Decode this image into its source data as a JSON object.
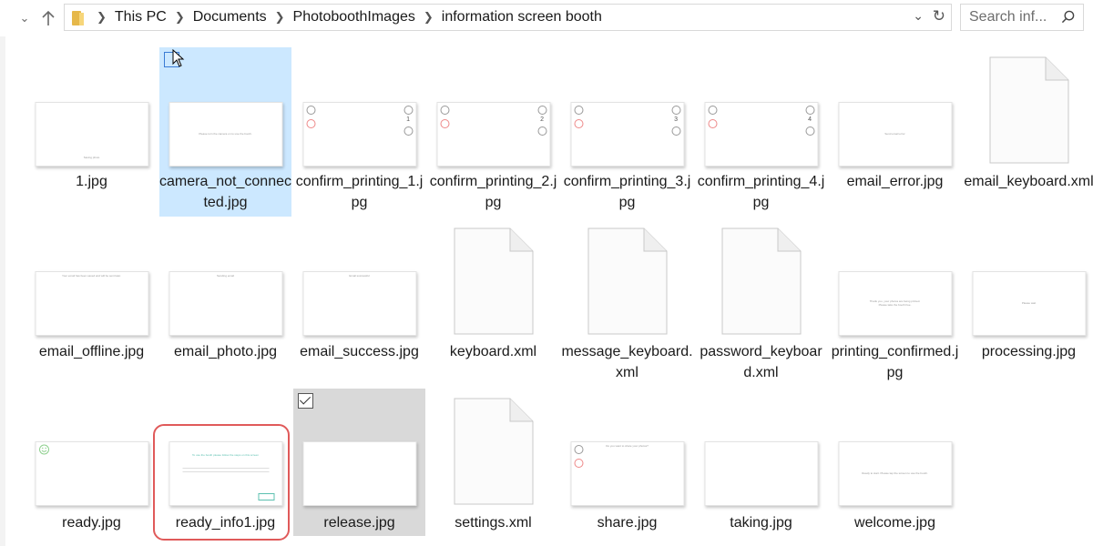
{
  "nav": {
    "back_icon": "back-arrow-icon",
    "forward_icon": "forward-arrow-icon",
    "recent_icon": "chevron-down-icon",
    "up_icon": "up-arrow-icon"
  },
  "breadcrumb": [
    "This PC",
    "Documents",
    "PhotoboothImages",
    "information screen booth"
  ],
  "search": {
    "placeholder": "Search inf..."
  },
  "items": [
    {
      "label": "1.jpg",
      "kind": "image",
      "thumb_text": "Saving photo"
    },
    {
      "label": "camera_not_connected.jpg",
      "kind": "image",
      "thumb_text": "Please turn the camera on to use the booth."
    },
    {
      "label": "confirm_printing_1.jpg",
      "kind": "confirm",
      "count": "1"
    },
    {
      "label": "confirm_printing_2.jpg",
      "kind": "confirm",
      "count": "2"
    },
    {
      "label": "confirm_printing_3.jpg",
      "kind": "confirm",
      "count": "3"
    },
    {
      "label": "confirm_printing_4.jpg",
      "kind": "confirm",
      "count": "4"
    },
    {
      "label": "email_error.jpg",
      "kind": "image",
      "thumb_text": "Send email error"
    },
    {
      "label": "email_keyboard.xml",
      "kind": "file"
    },
    {
      "label": "email_offline.jpg",
      "kind": "image",
      "thumb_text": "Your email has been saved and will be sent later."
    },
    {
      "label": "email_photo.jpg",
      "kind": "image",
      "thumb_text": "Sending email"
    },
    {
      "label": "email_success.jpg",
      "kind": "image",
      "thumb_text": "Email successful"
    },
    {
      "label": "keyboard.xml",
      "kind": "file"
    },
    {
      "label": "message_keyboard.xml",
      "kind": "file"
    },
    {
      "label": "password_keyboard.xml",
      "kind": "file"
    },
    {
      "label": "printing_confirmed.jpg",
      "kind": "image",
      "thumb_text": "Thank you, your photos are being printed. Please take the booth free."
    },
    {
      "label": "processing.jpg",
      "kind": "image",
      "thumb_text": "Please wait"
    },
    {
      "label": "ready.jpg",
      "kind": "ready"
    },
    {
      "label": "ready_info1.jpg",
      "kind": "ready_info",
      "thumb_text": "To use the booth please follow the steps on this screen"
    },
    {
      "label": "release.jpg",
      "kind": "image",
      "thumb_text": ""
    },
    {
      "label": "settings.xml",
      "kind": "file"
    },
    {
      "label": "share.jpg",
      "kind": "share",
      "thumb_text": "Do you want to share your photos?"
    },
    {
      "label": "taking.jpg",
      "kind": "image",
      "thumb_text": ""
    },
    {
      "label": "welcome.jpg",
      "kind": "image",
      "thumb_text": "Ready to start. Please tap the screen to use the booth."
    }
  ],
  "selection": {
    "hovered": "camera_not_connected.jpg",
    "checked": "release.jpg",
    "highlighted": "ready_info1.jpg"
  },
  "colors": {
    "hover_bg": "#cce8ff",
    "checked_bg": "#d9d9d9",
    "highlight_border": "#e05a5a",
    "folder": "#e6b84a"
  }
}
